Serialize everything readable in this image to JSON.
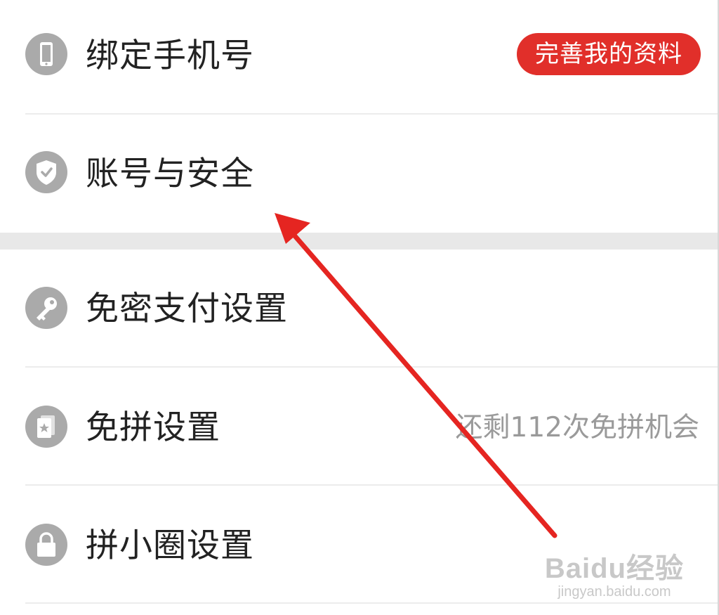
{
  "settings": {
    "items": [
      {
        "label": "绑定手机号",
        "icon": "phone-icon",
        "badge": "完善我的资料"
      },
      {
        "label": "账号与安全",
        "icon": "shield-check-icon"
      },
      {
        "label": "免密支付设置",
        "icon": "key-icon"
      },
      {
        "label": "免拼设置",
        "icon": "card-star-icon",
        "hint": "还剩112次免拼机会"
      },
      {
        "label": "拼小圈设置",
        "icon": "lock-icon"
      }
    ]
  },
  "annotation": {
    "arrow_color": "#e52521",
    "points_to": "账号与安全"
  },
  "watermark": {
    "main": "Baidu经验",
    "sub": "jingyan.baidu.com"
  },
  "colors": {
    "badge_bg": "#e12f2a",
    "icon_bg": "#aaaaaa",
    "label_text": "#222222",
    "hint_text": "#9a9a9a",
    "section_gap": "#e8e8e8"
  }
}
